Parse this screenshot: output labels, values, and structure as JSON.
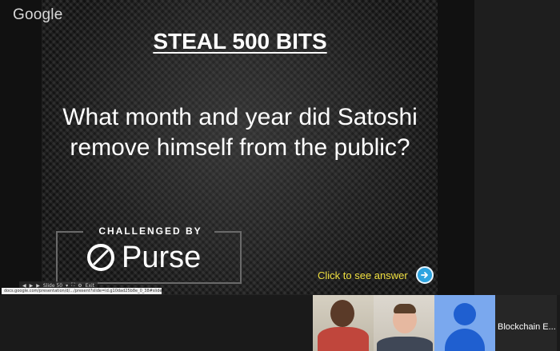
{
  "slide": {
    "logo": "Google",
    "title": "STEAL 500 BITS",
    "question": "What month and year did Satoshi remove himself from the public?",
    "sponsor_label": "CHALLENGED BY",
    "sponsor_brand": "Purse",
    "answer_link": "Click to see answer"
  },
  "presenter_controls": {
    "slide_label": "Slide 50",
    "exit_label": "Exit"
  },
  "url_bar": {
    "url": "docs.google.com/presentation/d/.../present?slide=id.g10dad25b8e_0_38#slide"
  },
  "gallery": {
    "participants": [
      {
        "name": "",
        "type": "video"
      },
      {
        "name": "",
        "type": "video"
      },
      {
        "name": "",
        "type": "avatar"
      },
      {
        "name": "Blockchain E...",
        "type": "name-only"
      }
    ]
  },
  "colors": {
    "answer_text": "#f0e040",
    "answer_arrow": "#2ea4e0",
    "avatar": "#1f5fd0"
  }
}
